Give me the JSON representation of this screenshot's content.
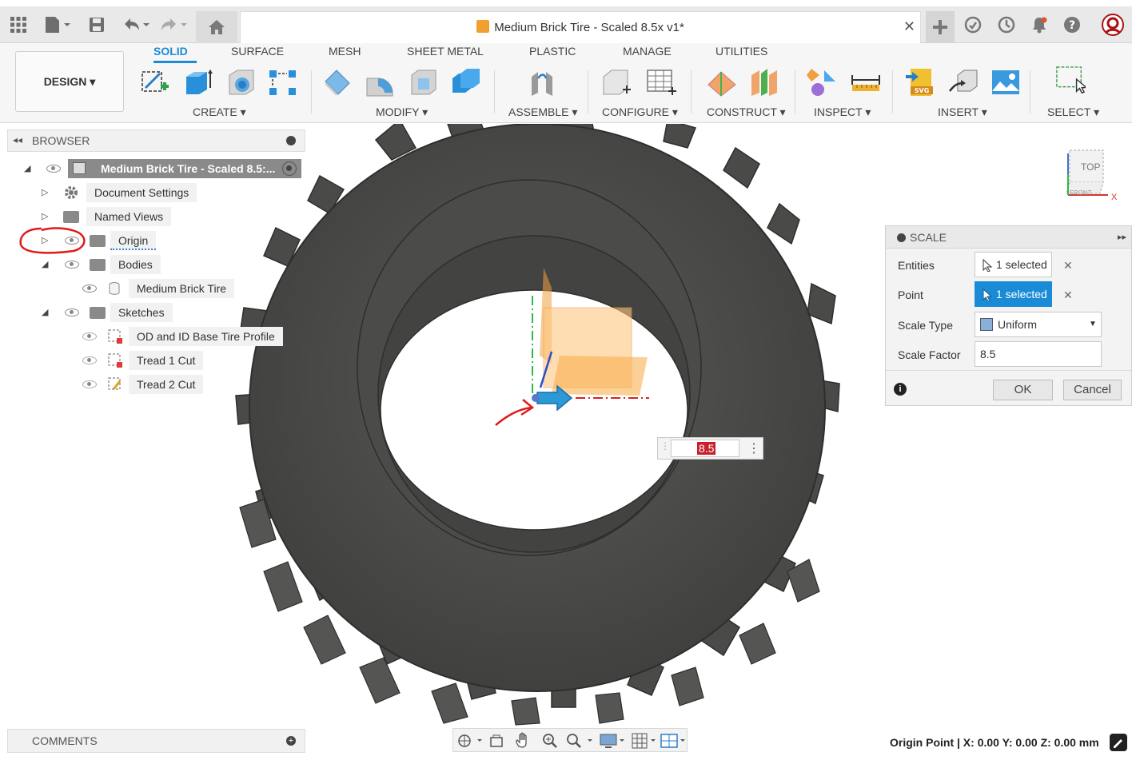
{
  "app": {
    "window_title": "Medium Brick Tire - Scaled 8.5x v1*"
  },
  "ribbon": {
    "workspace": "DESIGN",
    "tabs": [
      "SOLID",
      "SURFACE",
      "MESH",
      "SHEET METAL",
      "PLASTIC",
      "MANAGE",
      "UTILITIES"
    ],
    "active_tab": "SOLID",
    "groups": [
      "CREATE",
      "MODIFY",
      "ASSEMBLE",
      "CONFIGURE",
      "CONSTRUCT",
      "INSPECT",
      "INSERT",
      "SELECT"
    ],
    "accent_color": "#1a8bd6"
  },
  "browser": {
    "title": "BROWSER",
    "root": "Medium Brick Tire - Scaled 8.5:...",
    "items": [
      {
        "label": "Document Settings",
        "icon": "gear-icon"
      },
      {
        "label": "Named Views",
        "icon": "folder-icon"
      },
      {
        "label": "Origin",
        "icon": "folder-icon"
      },
      {
        "label": "Bodies",
        "icon": "folder-icon"
      },
      {
        "label": "Medium Brick Tire",
        "icon": "body-icon"
      },
      {
        "label": "Sketches",
        "icon": "folder-icon"
      },
      {
        "label": "OD and ID Base Tire Profile",
        "icon": "sketch-icon"
      },
      {
        "label": "Tread 1 Cut",
        "icon": "sketch-icon"
      },
      {
        "label": "Tread 2 Cut",
        "icon": "sketch-icon"
      }
    ]
  },
  "scale_dialog": {
    "title": "SCALE",
    "entities_label": "Entities",
    "entities_value": "1 selected",
    "point_label": "Point",
    "point_value": "1 selected",
    "scale_type_label": "Scale Type",
    "scale_type_value": "Uniform",
    "scale_factor_label": "Scale Factor",
    "scale_factor_value": "8.5",
    "ok_label": "OK",
    "cancel_label": "Cancel"
  },
  "viewport": {
    "inline_value": "8.5",
    "viewcube_top": "TOP",
    "viewcube_front": "FRONT",
    "viewcube_x": "X"
  },
  "comments": {
    "title": "COMMENTS"
  },
  "status": {
    "text": "Origin Point | X: 0.00 Y: 0.00 Z: 0.00 mm"
  }
}
